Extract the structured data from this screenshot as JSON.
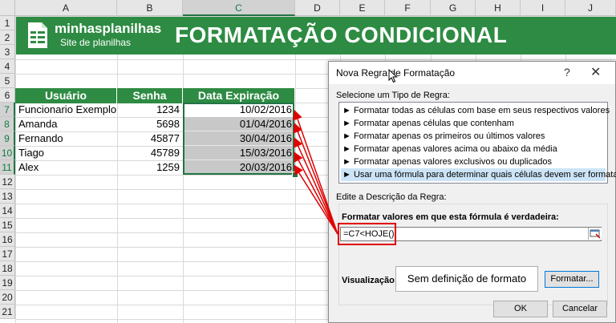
{
  "columns": [
    "A",
    "B",
    "C",
    "D",
    "E",
    "F",
    "G",
    "H",
    "I",
    "J"
  ],
  "rows": [
    "1",
    "2",
    "3",
    "4",
    "5",
    "6",
    "7",
    "8",
    "9",
    "10",
    "11",
    "12",
    "13",
    "14",
    "15",
    "16",
    "17",
    "18",
    "19",
    "20",
    "21"
  ],
  "banner": {
    "brand": "minhasplanilhas",
    "brand_sub": "Site de planilhas",
    "title": "FORMATAÇÃO CONDICIONAL",
    "logo_icon": "spreadsheet-logo-icon"
  },
  "table": {
    "headers": [
      "Usuário",
      "Senha",
      "Data Expiração"
    ],
    "rows": [
      [
        "Funcionario Exemplo",
        "1234",
        "10/02/2016"
      ],
      [
        "Amanda",
        "5698",
        "01/04/2016"
      ],
      [
        "Fernando",
        "45877",
        "30/04/2016"
      ],
      [
        "Tiago",
        "45789",
        "15/03/2016"
      ],
      [
        "Alex",
        "1259",
        "20/03/2016"
      ]
    ]
  },
  "dialog": {
    "title": "Nova Regra de Formatação",
    "help": "?",
    "close": "✕",
    "select_type_label": "Selecione um Tipo de Regra:",
    "rule_types": [
      "► Formatar todas as células com base em seus respectivos valores",
      "► Formatar apenas células que contenham",
      "► Formatar apenas os primeiros ou últimos valores",
      "► Formatar apenas valores acima ou abaixo da média",
      "► Formatar apenas valores exclusivos ou duplicados",
      "► Usar uma fórmula para determinar quais células devem ser formatadas"
    ],
    "selected_rule_index": 5,
    "edit_desc_label": "Edite a Descrição da Regra:",
    "formula_label": "Formatar valores em que esta fórmula é verdadeira:",
    "formula_value": "=C7<HOJE()",
    "preview_label": "Visualização:",
    "preview_text": "Sem definição de formato",
    "format_button": "Formatar...",
    "ok_button": "OK",
    "cancel_button": "Cancelar"
  },
  "colors": {
    "banner_green": "#2e8b43",
    "highlight_red": "#e00000",
    "shaded_cell": "#c8c8c8"
  }
}
